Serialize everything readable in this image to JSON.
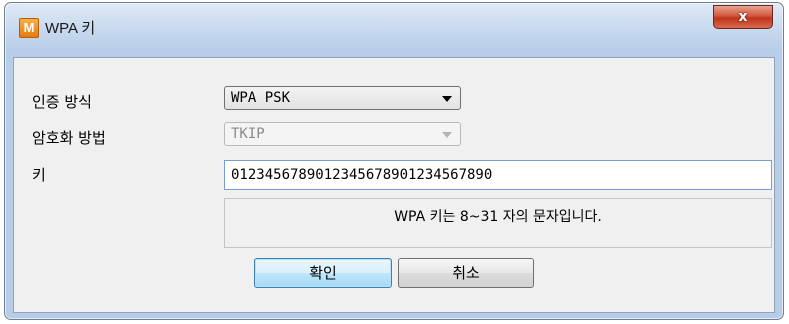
{
  "window": {
    "title": "WPA 키",
    "app_icon_letter": "M",
    "close_symbol": "x"
  },
  "form": {
    "auth_label": "인증 방식",
    "auth_value": "WPA PSK",
    "encryption_label": "암호화 방법",
    "encryption_value": "TKIP",
    "key_label": "키",
    "key_value": "012345678901234567890123456789​0",
    "info_text": "WPA 키는 8~31 자의 문자입니다."
  },
  "buttons": {
    "ok_label": "확인",
    "cancel_label": "취소"
  },
  "colors": {
    "close_button": "#c7442a",
    "default_button_border": "#3c7fb1",
    "app_icon": "#e8891f"
  }
}
